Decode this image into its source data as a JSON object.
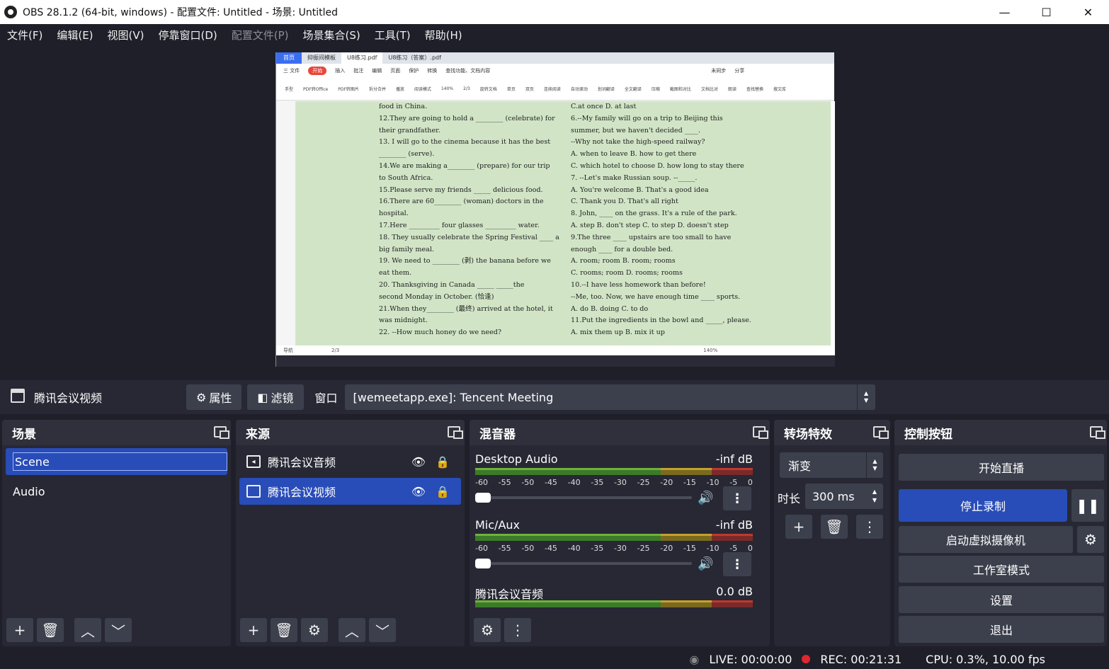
{
  "window": {
    "title": "OBS 28.1.2 (64-bit, windows) - 配置文件: Untitled - 场景: Untitled",
    "minimize": "—",
    "maximize": "☐",
    "close": "✕"
  },
  "menu": [
    "文件(F)",
    "编辑(E)",
    "视图(V)",
    "停靠窗口(D)",
    "配置文件(P)",
    "场景集合(S)",
    "工具(T)",
    "帮助(H)"
  ],
  "preview": {
    "tabs": [
      "首页",
      "抑振间模板",
      "U8练习.pdf",
      "U8练习（答案）.pdf"
    ],
    "menu": [
      "三 文件",
      "开始",
      "插入",
      "批注",
      "编辑",
      "页面",
      "保护",
      "转换",
      "查找功能、文档内容",
      "未同步",
      "分享"
    ],
    "tools": [
      "手型",
      "PDF转Office",
      "PDF转图片",
      "拆分合并",
      "播放",
      "阅读模式",
      "140%",
      "2/3",
      "旋转文档",
      "单页",
      "双页",
      "连续阅读",
      "自动滚动",
      "划词翻译",
      "全文翻译",
      "压缩",
      "截图和对比",
      "文档比对",
      "朗读",
      "查找替换",
      "搜文库"
    ],
    "left_col": [
      "food in China.",
      "12.They are going to hold a ________ (celebrate) for",
      "their grandfather.",
      "13. I will go to the cinema because it has the best",
      "________ (serve).",
      "14.We are making a________ (prepare) for our trip",
      "to South Africa.",
      "15.Please serve my friends _____ delicious food.",
      "16.There are 60________ (woman) doctors in the",
      "hospital.",
      "17.Here _________ four glasses _________ water.",
      "18. They usually celebrate the Spring Festival ____ a",
      "big family meal.",
      "19. We need to ________ (剥) the banana before we",
      "eat them.",
      "20. Thanksgiving in Canada _____ _____the",
      "second Monday in October. (恰逢)",
      "21.When they________ (最终) arrived at the hotel, it",
      "was midnight.",
      "22. --How much honey do we need?"
    ],
    "right_col": [
      "C.at once                  D. at last",
      "6.--My family will go on a trip to Beijing this",
      "summer, but we haven't decided ____.",
      "  --Why not take the high-speed railway?",
      "A. when to leave            B. how to get there",
      "C. which hotel to choose   D. how long to stay there",
      "7. --Let's make Russian soup.    --_____.",
      "A. You're welcome         B. That's a good idea",
      "C. Thank you                D. That's all right",
      "8. John, ____ on the grass. It's a rule of the park.",
      "A.  step B. don't step C. to step D. doesn't step",
      "9.The three ____ upstairs are too small to have",
      "enough ____ for a double bed.",
      "A. room; room         B. room; rooms",
      "C. rooms; room      D. rooms; rooms",
      "10.--I have less homework than before!",
      "   --Me, too. Now, we have enough time ____ sports.",
      "A. do             B. doing           C. to do",
      "11.Put the ingredients in the bowl and _____, please.",
      "A. mix them up        B. mix it up"
    ],
    "status": [
      "导航",
      "2/3",
      "140%"
    ]
  },
  "source_bar": {
    "name": "腾讯会议视频",
    "properties": "属性",
    "filters": "滤镜",
    "window_label": "窗口",
    "window_value": "[wemeetapp.exe]: Tencent Meeting"
  },
  "scenes": {
    "title": "场景",
    "items": [
      "Scene",
      "Audio"
    ]
  },
  "sources": {
    "title": "来源",
    "items": [
      {
        "label": "腾讯会议音频",
        "icon": "speaker-icon"
      },
      {
        "label": "腾讯会议视频",
        "icon": "window-icon"
      }
    ]
  },
  "mixer": {
    "title": "混音器",
    "scale": [
      "-60",
      "-55",
      "-50",
      "-45",
      "-40",
      "-35",
      "-30",
      "-25",
      "-20",
      "-15",
      "-10",
      "-5",
      "0"
    ],
    "channels": [
      {
        "name": "Desktop Audio",
        "db": "-inf dB"
      },
      {
        "name": "Mic/Aux",
        "db": "-inf dB"
      },
      {
        "name": "腾讯会议音频",
        "db": "0.0 dB"
      }
    ]
  },
  "transitions": {
    "title": "转场特效",
    "type": "渐变",
    "duration_label": "时长",
    "duration": "300 ms"
  },
  "controls": {
    "title": "控制按钮",
    "start_stream": "开始直播",
    "stop_record": "停止录制",
    "virtual_cam": "启动虚拟摄像机",
    "studio": "工作室模式",
    "settings": "设置",
    "exit": "退出"
  },
  "status": {
    "live": "LIVE: 00:00:00",
    "rec": "REC: 00:21:31",
    "cpu": "CPU: 0.3%, 10.00 fps"
  }
}
